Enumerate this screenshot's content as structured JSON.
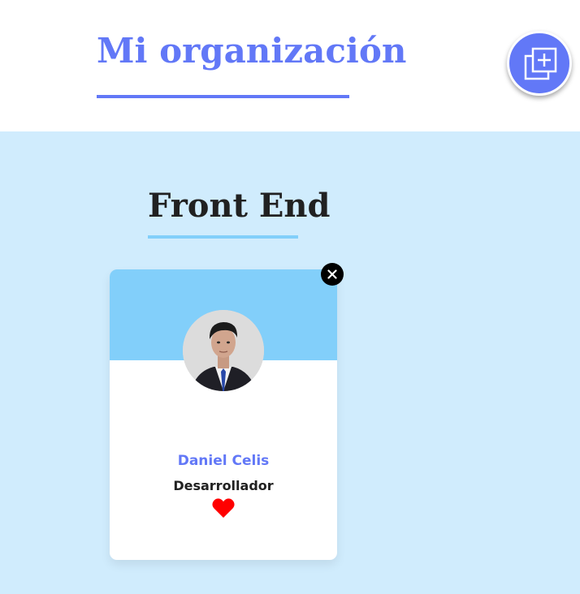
{
  "header": {
    "title": "Mi organización"
  },
  "actions": {
    "add_icon": "add-copy-icon"
  },
  "teams": [
    {
      "title": "Front End",
      "primary_color": "#82cffa",
      "secondary_color": "#d0ecfd",
      "members": [
        {
          "name": "Daniel Celis",
          "role": "Desarrollador",
          "favorite": true,
          "delete_icon": "close-icon",
          "favorite_icon": "heart-icon"
        }
      ]
    }
  ],
  "colors": {
    "accent": "#6278f7",
    "heart": "#ff0000"
  }
}
